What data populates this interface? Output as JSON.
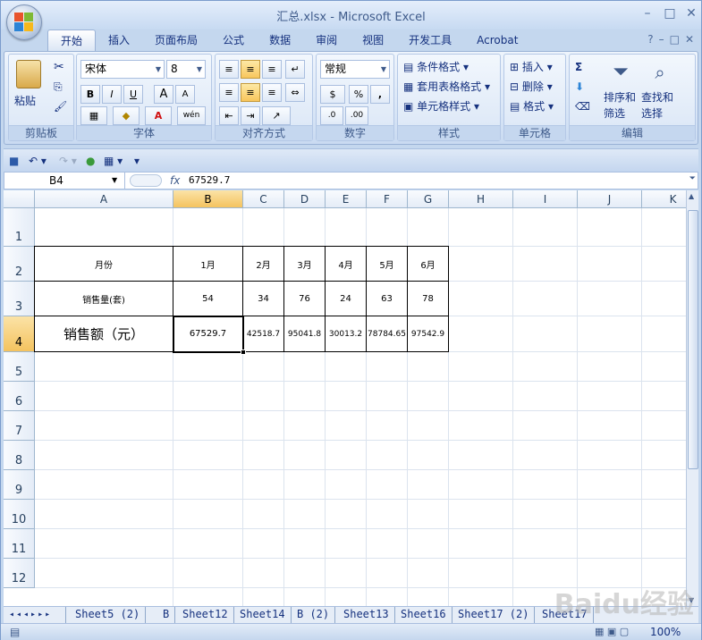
{
  "window": {
    "title": "汇总.xlsx - Microsoft Excel",
    "minimize": "–",
    "maximize": "□",
    "close": "✕"
  },
  "ribbon_tabs": [
    "开始",
    "插入",
    "页面布局",
    "公式",
    "数据",
    "审阅",
    "视图",
    "开发工具",
    "Acrobat"
  ],
  "ribbon_right": [
    "?",
    "–",
    "□",
    "✕"
  ],
  "ribbon": {
    "clipboard": {
      "label": "剪贴板",
      "paste": "粘贴"
    },
    "font": {
      "label": "字体",
      "font_name": "宋体",
      "font_size": "8",
      "bold": "B",
      "italic": "I",
      "underline": "U",
      "grow": "A",
      "shrink": "A",
      "phonetic": "wén",
      "font_color": "A"
    },
    "alignment": {
      "label": "对齐方式"
    },
    "number": {
      "label": "数字",
      "format": "常规",
      "percent": "%",
      "comma": ","
    },
    "styles": {
      "label": "样式",
      "conditional": "条件格式",
      "table": "套用表格格式",
      "cell_styles": "单元格样式"
    },
    "cells": {
      "label": "单元格",
      "insert": "插入",
      "delete": "删除",
      "format": "格式"
    },
    "editing": {
      "label": "编辑",
      "sort_filter_1": "排序和",
      "sort_filter_2": "筛选",
      "find_1": "查找和",
      "find_2": "选择",
      "sum": "Σ"
    }
  },
  "formula_bar": {
    "name_box": "B4",
    "fx": "fx",
    "value": "67529.7"
  },
  "columns": [
    "A",
    "B",
    "C",
    "D",
    "E",
    "F",
    "G",
    "H",
    "I",
    "J",
    "K"
  ],
  "rows": [
    "1",
    "2",
    "3",
    "4",
    "5",
    "6",
    "7",
    "8",
    "9",
    "10",
    "11",
    "12"
  ],
  "table": {
    "row2": [
      "月份",
      "1月",
      "2月",
      "3月",
      "4月",
      "5月",
      "6月"
    ],
    "row3": [
      "销售量(套)",
      "54",
      "34",
      "76",
      "24",
      "63",
      "78"
    ],
    "row4": [
      "销售额（元）",
      "67529.7",
      "42518.7",
      "95041.8",
      "30013.2",
      "78784.65",
      "97542.9"
    ]
  },
  "sheet_tabs": [
    "Sheet5 (2)",
    "B",
    "Sheet12",
    "Sheet14",
    "B (2)",
    "Sheet13",
    "Sheet16",
    "Sheet17 (2)",
    "Sheet17"
  ],
  "status": {
    "zoom": "100%"
  },
  "watermark": "Baidu经验"
}
